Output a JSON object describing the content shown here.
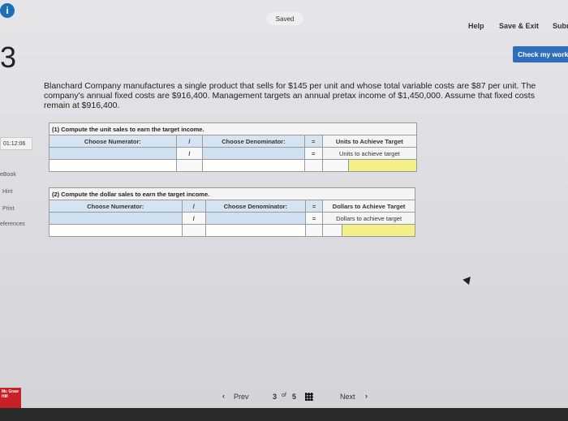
{
  "header": {
    "info_glyph": "i",
    "status": "Saved",
    "help": "Help",
    "save_exit": "Save & Exit",
    "submit": "Subr",
    "check_work": "Check my work"
  },
  "question": {
    "number": "3",
    "text": "Blanchard Company manufactures a single product that sells for $145 per unit and whose total variable costs are $87 per unit. The company's annual fixed costs are $916,400. Management targets an annual pretax income of $1,450,000. Assume that fixed costs remain at $916,400."
  },
  "sidebar": {
    "timer": "01:12:06",
    "ebook": "eBook",
    "hint": "Hint",
    "print": "Print",
    "references": "eferences"
  },
  "part1": {
    "title": "(1) Compute the unit sales to earn the target income.",
    "numerator_label": "Choose Numerator:",
    "slash": "/",
    "denominator_label": "Choose Denominator:",
    "equals": "=",
    "result_header": "Units to Achieve Target",
    "result_label": "Units to achieve target"
  },
  "part2": {
    "title": "(2) Compute the dollar sales to earn the target income.",
    "numerator_label": "Choose Numerator:",
    "slash": "/",
    "denominator_label": "Choose Denominator:",
    "equals": "=",
    "result_header": "Dollars to Achieve Target",
    "result_label": "Dollars to achieve target"
  },
  "nav": {
    "prev": "Prev",
    "page_current": "3",
    "page_of": "of",
    "page_total": "5",
    "next": "Next"
  },
  "logo": {
    "text": "Mc Graw Hill"
  },
  "colors": {
    "accent": "#2f6ebd",
    "header_cell": "#d6e4f1",
    "answer_cell": "#f3f08a"
  }
}
